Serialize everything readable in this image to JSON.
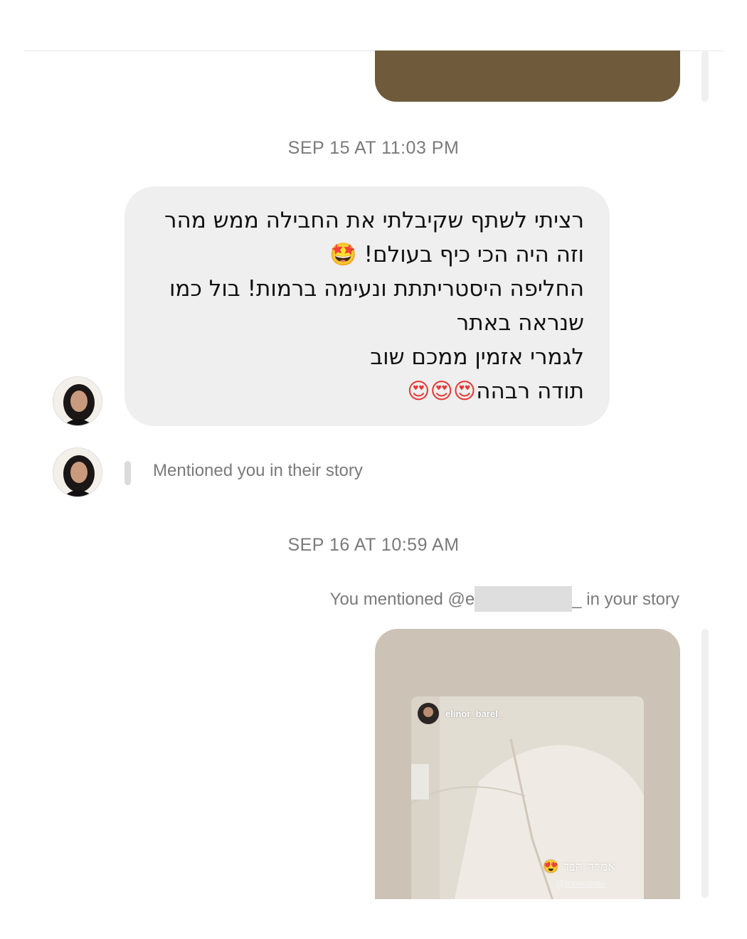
{
  "thread": {
    "timestamps": [
      "SEP 15 AT 11:03 PM",
      "SEP 16 AT 10:59 AM"
    ],
    "incoming_message": {
      "lines": [
        {
          "text": "רציתי לשתף שקיבלתי את החבילה ממש מהר",
          "emoji": ""
        },
        {
          "text": "וזה היה הכי כיף בעולם! ",
          "emoji": "🤩"
        },
        {
          "text": "החליפה היסטריתתת ונעימה ברמות! בול כמו",
          "emoji": ""
        },
        {
          "text": "שנראה באתר",
          "emoji": ""
        },
        {
          "text": "לגמרי אזמין ממכם שוב",
          "emoji": ""
        },
        {
          "text": "תודה רבהה",
          "emoji": "😍😍😍"
        }
      ]
    },
    "story_mention_notice": "Mentioned you in their story",
    "you_mentioned": {
      "prefix": "You mentioned @e",
      "suffix": "_ in your story"
    },
    "story_preview": {
      "username": "elinor_barel_",
      "caption": "אמלה הבד 😍",
      "tag": "@lorovanno"
    }
  },
  "colors": {
    "bubble_bg": "#efefef",
    "meta_text": "#7a7a7a",
    "prev_story_card": "#6f5b3b",
    "story_card_bg": "#ccc2b6"
  },
  "icons": [
    "avatar-photo",
    "avatar-photo",
    "story-avatar-photo"
  ]
}
